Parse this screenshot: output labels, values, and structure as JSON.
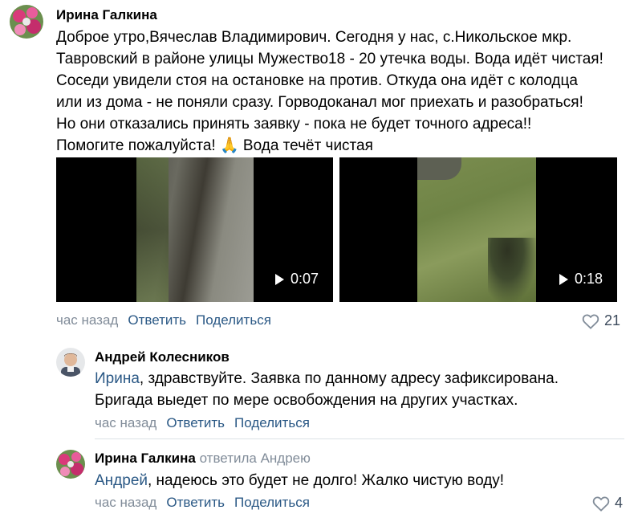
{
  "comments": [
    {
      "author": "Ирина Галкина",
      "lines": [
        "Доброе утро,Вячеслав Владимирович. Сегодня у нас, с.Никольское мкр.",
        "Тавровский в районе улицы Мужество18 - 20 утечка воды. Вода идёт чистая!",
        "Соседи увидели стоя на остановке на против. Откуда она идёт с колодца",
        "или из дома - не поняли сразу. Горводоканал мог приехать и разобраться!",
        "Но они отказались принять заявку - пока не будет точного адреса!!",
        "Помогите пожалуйста! "
      ],
      "emoji": "🙏",
      "after_emoji": " Вода течёт чистая",
      "videos": [
        {
          "duration": "0:07"
        },
        {
          "duration": "0:18"
        }
      ],
      "time": "час назад",
      "reply_label": "Ответить",
      "share_label": "Поделиться",
      "likes": "21"
    },
    {
      "author": "Андрей Колесников",
      "mention": "Ирина",
      "line1_rest": ", здравствуйте. Заявка по данному адресу зафиксирована.",
      "line2": "Бригада выедет по мере освобождения на других участках.",
      "time": "час назад",
      "reply_label": "Ответить",
      "share_label": "Поделиться"
    },
    {
      "author": "Ирина Галкина",
      "reply_to": "ответила Андрею",
      "mention": "Андрей",
      "line1_rest": ", надеюсь это будет не долго! Жалко чистую воду!",
      "time": "час назад",
      "reply_label": "Ответить",
      "share_label": "Поделиться",
      "likes": "4"
    }
  ],
  "colors": {
    "link": "#2a5885",
    "muted": "#818c99",
    "separator": "#dce1e6"
  },
  "icons": [
    "avatar-flowers",
    "avatar-man",
    "play-icon",
    "heart-icon"
  ]
}
